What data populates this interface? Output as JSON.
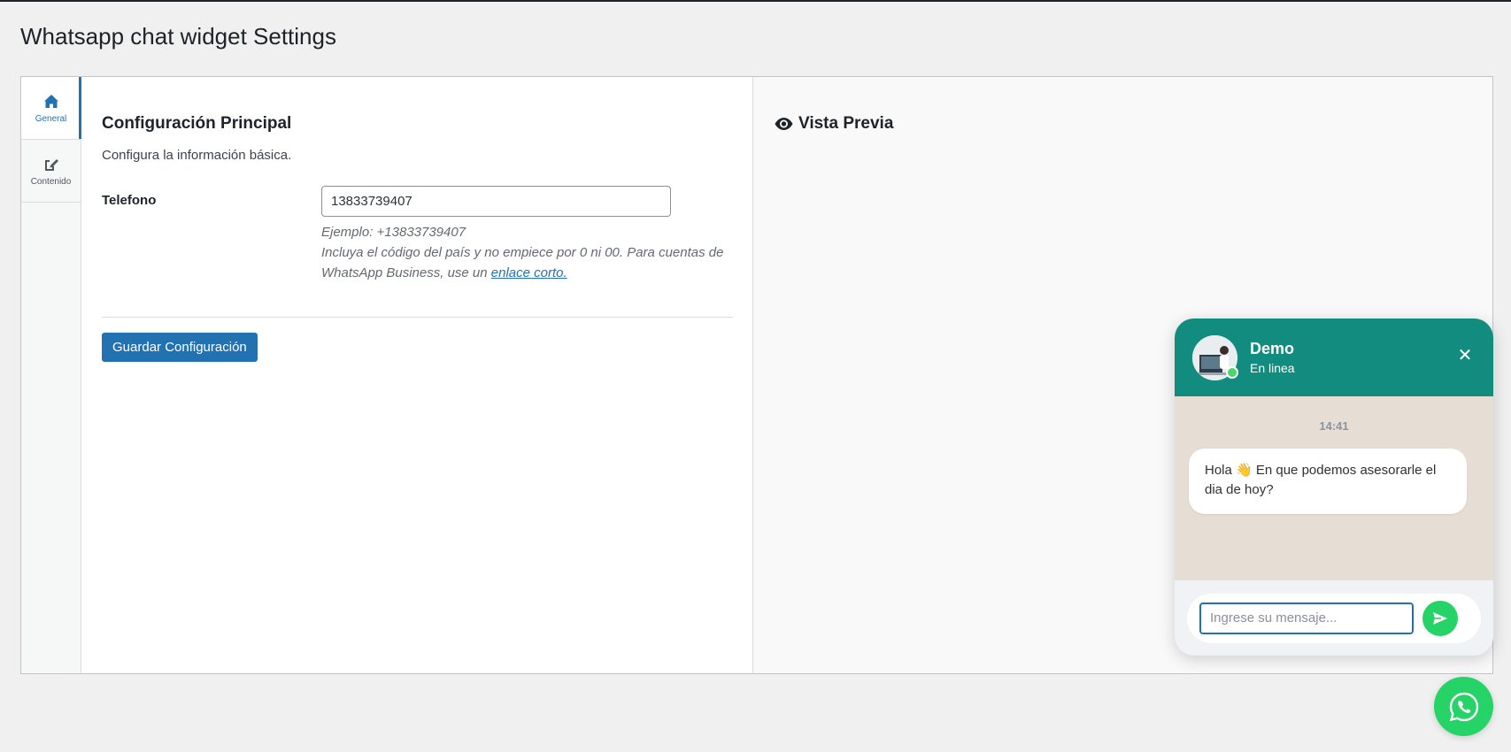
{
  "page": {
    "title": "Whatsapp chat widget Settings"
  },
  "tabs": [
    {
      "label": "General",
      "icon": "home-icon",
      "active": true
    },
    {
      "label": "Contenido",
      "icon": "edit-icon",
      "active": false
    }
  ],
  "main": {
    "section_title": "Configuración Principal",
    "section_desc": "Configura la información básica.",
    "phone": {
      "label": "Telefono",
      "value": "13833739407",
      "example": "Ejemplo: +13833739407",
      "help_text": "Incluya el código del país y no empiece por 0 ni 00. Para cuentas de WhatsApp Business, use un",
      "link_text": "enlace corto."
    },
    "save_label": "Guardar Configuración"
  },
  "preview": {
    "title": "Vista Previa",
    "icon": "eye-icon"
  },
  "chat": {
    "name": "Demo",
    "status": "En linea",
    "time": "14:41",
    "message": "Hola 👋 En que podemos asesorarle el dia de hoy?",
    "input_placeholder": "Ingrese su mensaje...",
    "header_color": "#128c7e",
    "accent_color": "#25d366"
  }
}
